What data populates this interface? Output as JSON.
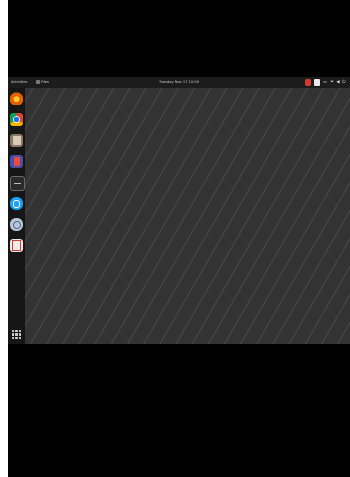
{
  "topbar": {
    "activities_label": "Activities",
    "app_label": "Files",
    "clock": "Tuesday Nov 17 10:00",
    "input_language": "en",
    "system_menu": "⏷ ◀ ⏻"
  },
  "dock": {
    "items": [
      {
        "name": "firefox",
        "color": "#e66000"
      },
      {
        "name": "chrome",
        "color": "#1a73e8"
      },
      {
        "name": "files",
        "color": "#8a7a61"
      },
      {
        "name": "libreoffice",
        "color": "#4b4ea8"
      },
      {
        "name": "terminal",
        "color": "#2b2b2b"
      },
      {
        "name": "skype",
        "color": "#1da1f2"
      },
      {
        "name": "disk-utility",
        "color": "#6c8ebf"
      },
      {
        "name": "document-viewer",
        "color": "#d83a30"
      }
    ]
  },
  "colors": {
    "topbar_bg": "#1c1c1c",
    "desktop_bg": "#3a3a3a",
    "dock_bg": "#161616"
  }
}
